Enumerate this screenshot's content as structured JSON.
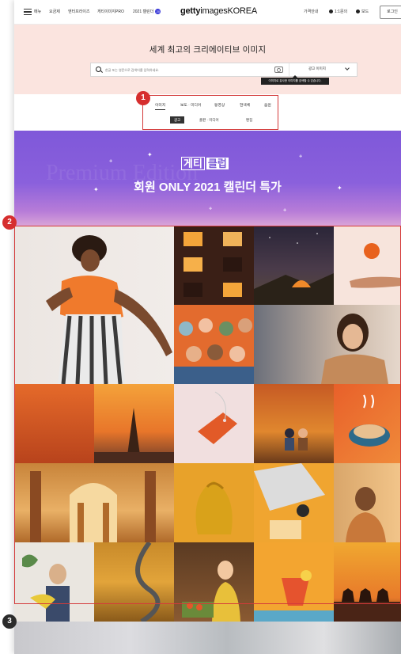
{
  "topnav": {
    "menu_label": "메뉴",
    "links": [
      "요금제",
      "엔터프라이즈",
      "게티이미지PRO",
      "2021 캘린더"
    ],
    "calendar_badge": "20",
    "logo_bold": "getty",
    "logo_rest": "imagesKOREA",
    "right_links": [
      "가격안내",
      "1:1문의",
      "보드"
    ],
    "login_label": "로그인"
  },
  "hero": {
    "title": "세계 최고의 크리에이티브 이미지",
    "search_placeholder": "한글 또는 영문으로 검색어를 입력하세요.",
    "category_value": "광고 이미지",
    "tooltip": "이미지로 유사한 이미지를 검색할 수 있습니다."
  },
  "tabs": {
    "main": [
      "이미지",
      "보도 · 미디어",
      "동영상",
      "현색체",
      "음원"
    ],
    "sub": [
      "광고",
      "출판 · 미디어",
      "편집"
    ]
  },
  "banner": {
    "watermark": "Premium Edition",
    "badge_a": "게티",
    "badge_b": "클럽",
    "title": "회원 ONLY 2021 캘린더 특가"
  },
  "markers": [
    "1",
    "2",
    "3"
  ]
}
